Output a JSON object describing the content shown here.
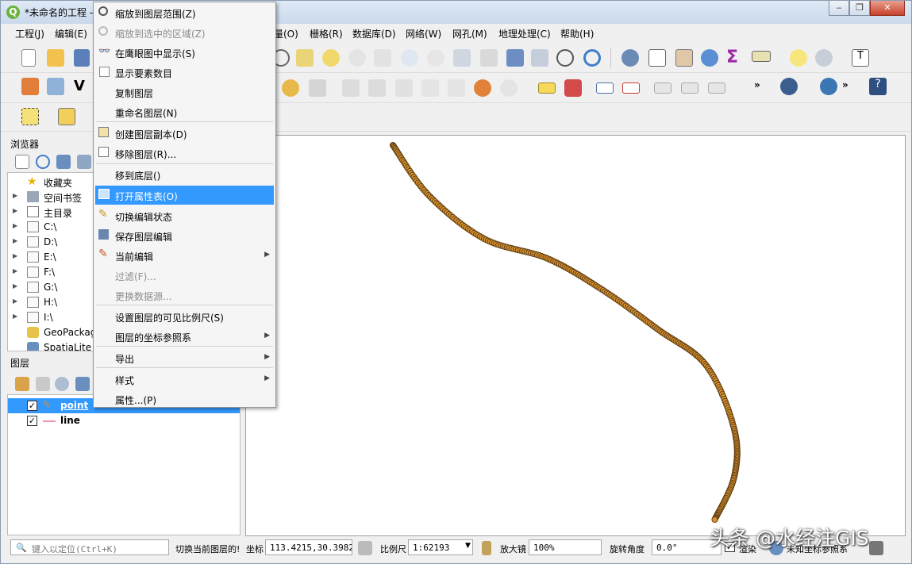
{
  "window": {
    "title": "*未命名的工程 -",
    "app_icon": "Q"
  },
  "menubar": {
    "items": [
      "工程(J)",
      "编辑(E)",
      "量(O)",
      "栅格(R)",
      "数据库(D)",
      "网络(W)",
      "网孔(M)",
      "地理处理(C)",
      "帮助(H)"
    ]
  },
  "browser": {
    "title": "浏览器",
    "items": [
      {
        "label": "收藏夹",
        "icon": "star-icon"
      },
      {
        "label": "空间书签",
        "icon": "bookmark-icon"
      },
      {
        "label": "主目录",
        "icon": "home-folder-icon"
      },
      {
        "label": "C:\\",
        "icon": "folder-icon"
      },
      {
        "label": "D:\\",
        "icon": "folder-icon"
      },
      {
        "label": "E:\\",
        "icon": "folder-icon"
      },
      {
        "label": "F:\\",
        "icon": "folder-icon"
      },
      {
        "label": "G:\\",
        "icon": "folder-icon"
      },
      {
        "label": "H:\\",
        "icon": "folder-icon"
      },
      {
        "label": "I:\\",
        "icon": "folder-icon"
      },
      {
        "label": "GeoPackage",
        "icon": "geopackage-icon"
      },
      {
        "label": "SpatiaLite",
        "icon": "spatialite-icon"
      }
    ]
  },
  "layers": {
    "title": "图层",
    "items": [
      {
        "label": "point",
        "checked": "✓",
        "selected": true
      },
      {
        "label": "line",
        "checked": "✓",
        "selected": false
      }
    ]
  },
  "context_menu": {
    "items": [
      {
        "label": "缩放到图层范围(Z)",
        "icon": "zoom-layer-icon",
        "disabled": false
      },
      {
        "label": "缩放到选中的区域(Z)",
        "icon": "zoom-selection-icon",
        "disabled": true
      },
      {
        "label": "在鹰眼图中显示(S)",
        "icon": "overview-icon",
        "disabled": false
      },
      {
        "label": "显示要素数目",
        "icon": "checkbox-icon",
        "disabled": false
      },
      {
        "label": "复制图层",
        "icon": "",
        "disabled": false
      },
      {
        "label": "重命名图层(N)",
        "icon": "",
        "disabled": false
      },
      {
        "label": "创建图层副本(D)",
        "icon": "duplicate-layer-icon",
        "disabled": false
      },
      {
        "label": "移除图层(R)...",
        "icon": "remove-layer-icon",
        "disabled": false
      },
      {
        "label": "移到底层()",
        "icon": "",
        "disabled": false
      },
      {
        "label": "打开属性表(O)",
        "icon": "attribute-table-icon",
        "disabled": false
      },
      {
        "label": "切换编辑状态",
        "icon": "pencil-icon",
        "disabled": false
      },
      {
        "label": "保存图层编辑",
        "icon": "save-edits-icon",
        "disabled": false
      },
      {
        "label": "当前编辑",
        "icon": "current-edits-icon",
        "disabled": false
      },
      {
        "label": "过滤(F)...",
        "icon": "",
        "disabled": true
      },
      {
        "label": "更换数据源...",
        "icon": "",
        "disabled": true
      },
      {
        "label": "设置图层的可见比例尺(S)",
        "icon": "",
        "disabled": false
      },
      {
        "label": "图层的坐标参照系",
        "icon": "",
        "disabled": false
      },
      {
        "label": "导出",
        "icon": "",
        "disabled": false
      },
      {
        "label": "样式",
        "icon": "",
        "disabled": false
      },
      {
        "label": "属性...(P)",
        "icon": "",
        "disabled": false
      }
    ]
  },
  "statusbar": {
    "locator_placeholder": "键入以定位(Ctrl+K)",
    "hint": "切换当前图层的!",
    "coord_label": "坐标",
    "coord_value": "113.4215,30.3982",
    "scale_label": "比例尺",
    "scale_value": "1:62193",
    "magnifier_label": "放大镜",
    "magnifier_value": "100%",
    "rotation_label": "旋转角度",
    "rotation_value": "0.0°",
    "render_label": "渲染",
    "crs_label": "未知坐标参照系"
  },
  "watermark": "头条 @水经注GIS",
  "colors": {
    "accent": "#3399ff",
    "feature_fill": "#d6912e",
    "feature_stroke": "#5a3a12"
  }
}
